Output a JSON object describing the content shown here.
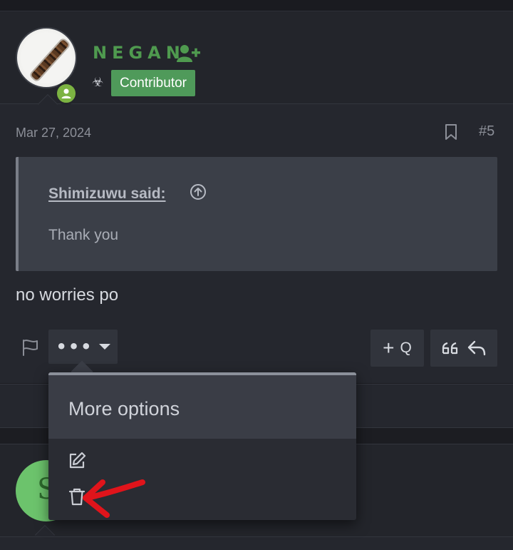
{
  "post": {
    "user": {
      "name": "NEGAN",
      "badge": "Contributor"
    },
    "date": "Mar 27, 2024",
    "number": "#5",
    "quote": {
      "author": "Shimizuwu said:",
      "text": "Thank you"
    },
    "body": "no worries po",
    "actions": {
      "multiquote_plus": "+",
      "multiquote_label": "Q"
    }
  },
  "menu": {
    "title": "More options"
  },
  "icons": {
    "user_add": "user-plus-icon",
    "hazard": "biohazard-icon",
    "bookmark": "bookmark-icon",
    "flag": "flag-icon",
    "edit": "edit-icon",
    "delete": "trash-icon"
  },
  "colors": {
    "username": "#4f9a4f",
    "badge_bg": "#4f9a5a",
    "online": "#7cb342",
    "annotation": "#e0141b"
  }
}
